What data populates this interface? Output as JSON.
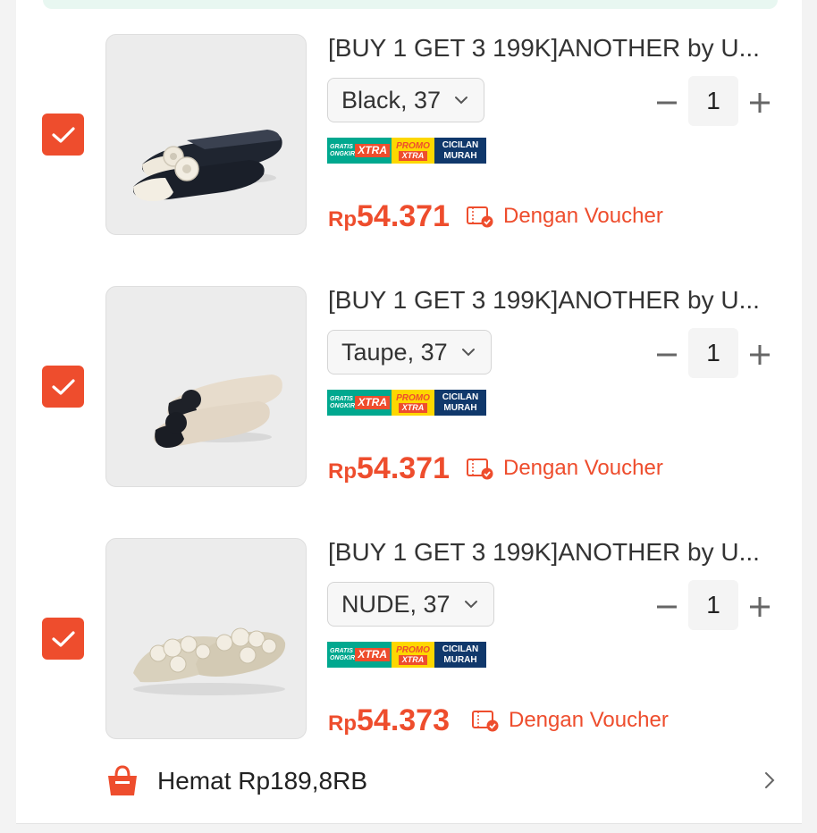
{
  "items": [
    {
      "title": "[BUY 1 GET 3 199K]ANOTHER by U...",
      "variant": "Black, 37",
      "quantity": "1",
      "price_currency": "Rp",
      "price_amount": "54.371",
      "voucher_label": "Dengan Voucher",
      "checked": true,
      "image": "black-lace-flat-shoes"
    },
    {
      "title": "[BUY 1 GET 3 199K]ANOTHER by U...",
      "variant": "Taupe, 37",
      "quantity": "1",
      "price_currency": "Rp",
      "price_amount": "54.371",
      "voucher_label": "Dengan Voucher",
      "checked": true,
      "image": "taupe-lace-flat-shoes"
    },
    {
      "title": "[BUY 1 GET 3 199K]ANOTHER by U...",
      "variant": "NUDE, 37",
      "quantity": "1",
      "price_currency": "Rp",
      "price_amount": "54.373",
      "voucher_label": "Dengan Voucher",
      "checked": true,
      "image": "nude-pearl-slides"
    }
  ],
  "badges": {
    "ongkir_top": "GRATIS",
    "ongkir_bottom": "ONGKIR",
    "ongkir_xtra": "XTRA",
    "promo_top": "PROMO",
    "promo_bottom": "XTRA",
    "cicilan_top": "CICILAN",
    "cicilan_bottom": "MURAH"
  },
  "savings": {
    "label": "Hemat Rp189,8RB",
    "icon": "shopping-bag-icon"
  },
  "colors": {
    "accent": "#ee4d2d",
    "text": "#333333",
    "badge_green": "#00a88f",
    "badge_yellow": "#fdd700",
    "badge_navy": "#10386b"
  }
}
